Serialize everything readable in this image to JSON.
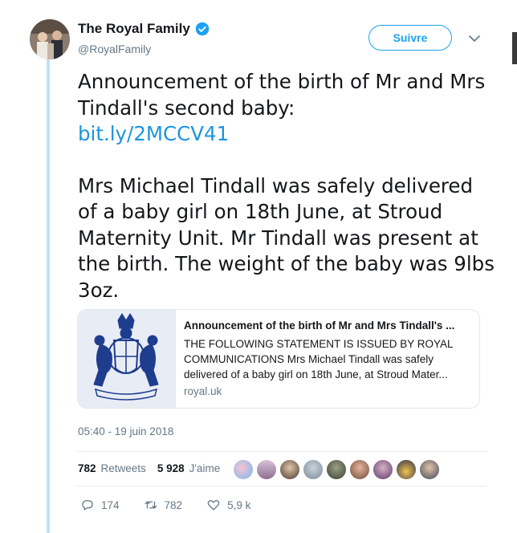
{
  "tweet": {
    "author_name": "The Royal Family",
    "author_handle": "@RoyalFamily",
    "follow_label": "Suivre",
    "text_line1": "Announcement of the birth of Mr and Mrs Tindall's second baby:",
    "link": "bit.ly/2MCCV41",
    "text_body": "Mrs Michael Tindall was safely delivered of a baby girl on 18th June, at Stroud Maternity Unit. Mr Tindall was present at the birth. The weight of the baby was 9lbs 3oz.",
    "timestamp": "05:40 - 19 juin 2018"
  },
  "card": {
    "title": "Announcement of the birth of Mr and Mrs Tindall's ...",
    "description": "THE FOLLOWING STATEMENT IS ISSUED BY ROYAL COMMUNICATIONS Mrs Michael Tindall was safely delivered of a baby girl on 18th June, at Stroud Mater...",
    "domain": "royal.uk"
  },
  "stats": {
    "retweets_count": "782",
    "retweets_label": "Retweets",
    "likes_count": "5 928",
    "likes_label": "J'aime"
  },
  "actions": {
    "reply_count": "174",
    "retweet_count": "782",
    "like_count": "5,9 k"
  },
  "colors": {
    "accent": "#1da1f2",
    "link": "#1b95e0",
    "muted": "#657786",
    "thread_line": "#bfe3f7"
  }
}
